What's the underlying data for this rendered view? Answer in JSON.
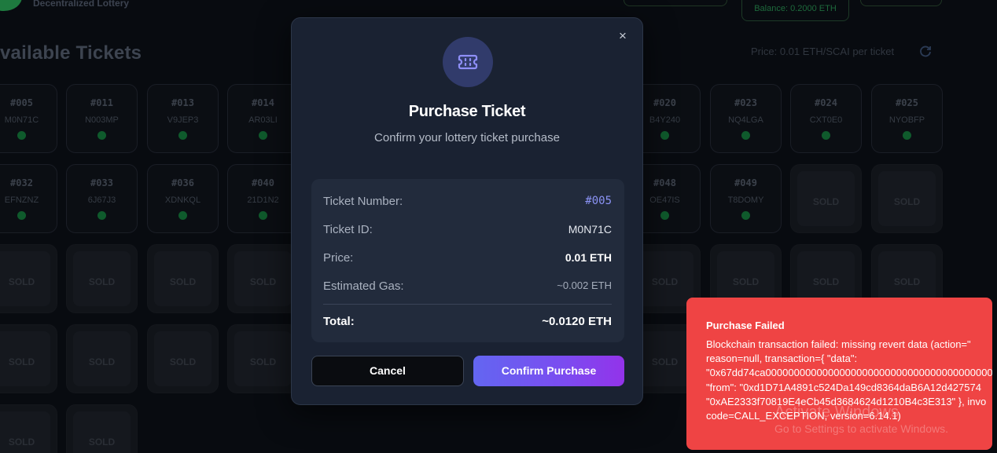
{
  "background": {
    "brand_subtitle": "Decentralized Lottery",
    "balance": "Balance: 0.2000 ETH",
    "section_title": "vailable Tickets",
    "price_note": "Price: 0.01 ETH/SCAI per ticket",
    "sold_label": "SOLD",
    "available_tickets": [
      {
        "number": "#005",
        "id": "M0N71C"
      },
      {
        "number": "#011",
        "id": "N003MP"
      },
      {
        "number": "#013",
        "id": "V9JEP3"
      },
      {
        "number": "#014",
        "id": "AR03LI"
      },
      {
        "number": "#020",
        "id": "B4Y240"
      },
      {
        "number": "#023",
        "id": "NQ4LGA"
      },
      {
        "number": "#024",
        "id": "CXT0E0"
      },
      {
        "number": "#025",
        "id": "NYOBFP"
      },
      {
        "number": "#032",
        "id": "EFNZNZ"
      },
      {
        "number": "#033",
        "id": "6J67J3"
      },
      {
        "number": "#036",
        "id": "XDNKQL"
      },
      {
        "number": "#040",
        "id": "21D1N2"
      },
      {
        "number": "#048",
        "id": "OE47IS"
      },
      {
        "number": "#049",
        "id": "T8DOMY"
      }
    ]
  },
  "modal": {
    "title": "Purchase Ticket",
    "subtitle": "Confirm your lottery ticket purchase",
    "rows": {
      "ticket_number": {
        "label": "Ticket Number:",
        "value": "#005"
      },
      "ticket_id": {
        "label": "Ticket ID:",
        "value": "M0N71C"
      },
      "price": {
        "label": "Price:",
        "value": "0.01 ETH"
      },
      "gas": {
        "label": "Estimated Gas:",
        "value": "~0.002 ETH"
      },
      "total": {
        "label": "Total:",
        "value": "~0.0120 ETH"
      }
    },
    "cancel_label": "Cancel",
    "confirm_label": "Confirm Purchase",
    "close_glyph": "×"
  },
  "toast": {
    "title": "Purchase Failed",
    "lines": [
      "Blockchain transaction failed: missing revert data (action=\"",
      "reason=null, transaction={ \"data\":",
      "\"0x67dd74ca000000000000000000000000000000000000000000",
      "\"from\": \"0xd1D71A4891c524Da149cd8364daB6A12d427574",
      "\"0xAE2333f70819E4eCb45d3684624d1210B4c3E313\" }, invo",
      "code=CALL_EXCEPTION, version=6.14.1)"
    ]
  },
  "watermark": {
    "title": "Activate Windows",
    "subtitle": "Go to Settings to activate Windows."
  },
  "colors": {
    "modal_bg": "#1a2232",
    "accent": "#6366f1",
    "accent_end": "#9333ea",
    "error": "#ef4444",
    "available_dot": "#0f5a2c"
  }
}
